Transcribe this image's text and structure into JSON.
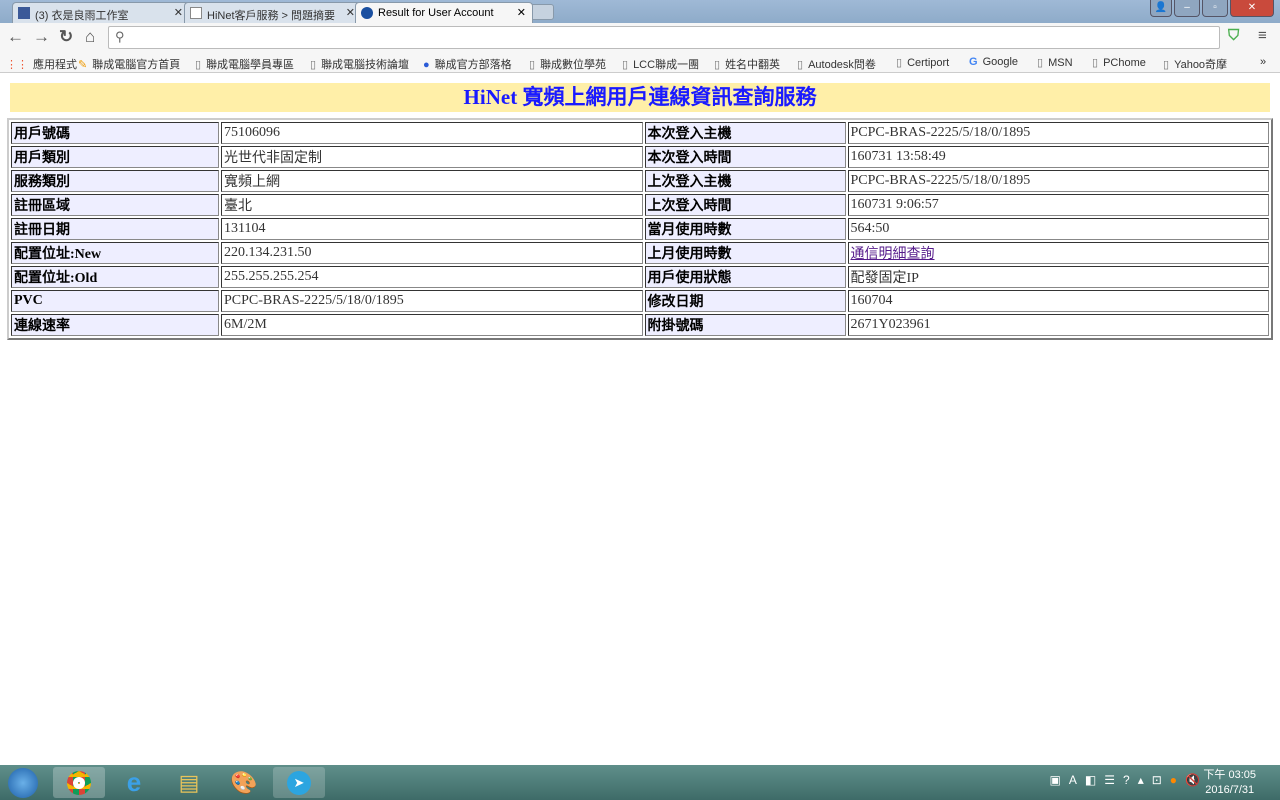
{
  "browser": {
    "tabs": [
      {
        "label": "(3) 衣是良雨工作室",
        "icon": "facebook-icon"
      },
      {
        "label": "HiNet客戶服務 > 問題摘要",
        "icon": "page-icon"
      },
      {
        "label": "Result for User Account",
        "icon": "hinet-icon"
      }
    ],
    "omnibox_value": "",
    "bookmarks": [
      "應用程式",
      "聯成電腦官方首頁",
      "聯成電腦學員專區",
      "聯成電腦技術論壇",
      "聯成官方部落格",
      "聯成數位學苑",
      "LCC聯成一團",
      "姓名中翻英",
      "Autodesk問卷",
      "Certiport",
      "Google",
      "MSN",
      "PChome",
      "Yahoo奇摩"
    ],
    "overflow": "»"
  },
  "page": {
    "title": "HiNet 寬頻上網用戶連線資訊查詢服務",
    "rows": [
      {
        "l1": "用戶號碼",
        "v1": "75106096",
        "l2": "本次登入主機",
        "v2": "PCPC-BRAS-2225/5/18/0/1895"
      },
      {
        "l1": "用戶類別",
        "v1": "光世代非固定制",
        "l2": "本次登入時間",
        "v2": "160731 13:58:49"
      },
      {
        "l1": "服務類別",
        "v1": "寬頻上網",
        "l2": "上次登入主機",
        "v2": "PCPC-BRAS-2225/5/18/0/1895"
      },
      {
        "l1": "註冊區域",
        "v1": "臺北",
        "l2": "上次登入時間",
        "v2": "160731 9:06:57"
      },
      {
        "l1": "註冊日期",
        "v1": "131104",
        "l2": "當月使用時數",
        "v2": "564:50"
      },
      {
        "l1": "配置位址:New",
        "v1": "220.134.231.50",
        "l2": "上月使用時數",
        "v2": "通信明細查詢"
      },
      {
        "l1": "配置位址:Old",
        "v1": "255.255.255.254",
        "l2": "用戶使用狀態",
        "v2": "配發固定IP"
      },
      {
        "l1": "PVC",
        "v1": "PCPC-BRAS-2225/5/18/0/1895",
        "l2": "修改日期",
        "v2": "160704"
      },
      {
        "l1": "連線速率",
        "v1": "6M/2M",
        "l2": "附掛號碼",
        "v2": "2671Y023961"
      }
    ]
  },
  "taskbar": {
    "time": "下午 03:05",
    "date": "2016/7/31"
  }
}
